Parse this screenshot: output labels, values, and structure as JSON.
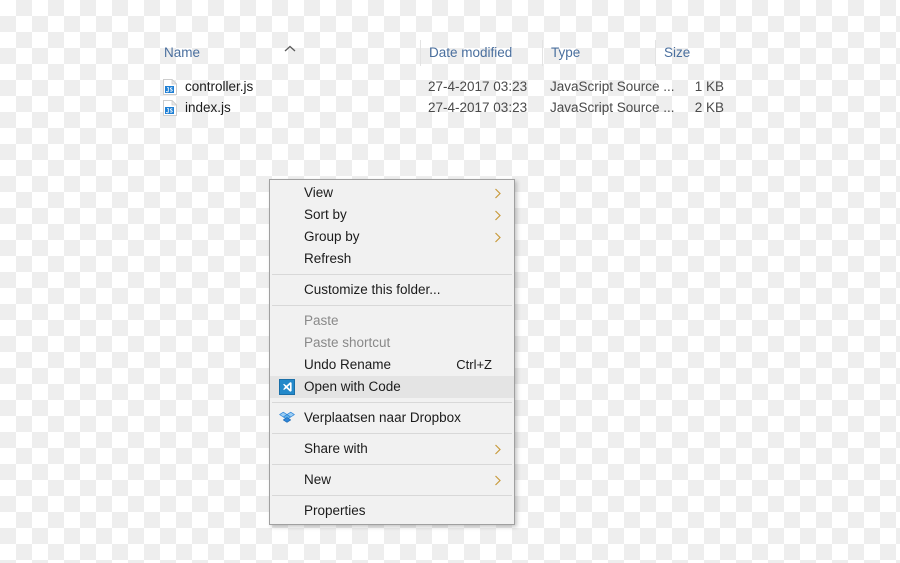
{
  "file_list": {
    "columns": [
      {
        "key": "name",
        "label": "Name",
        "sorted": true,
        "sort_direction": "ascending"
      },
      {
        "key": "date",
        "label": "Date modified"
      },
      {
        "key": "type",
        "label": "Type"
      },
      {
        "key": "size",
        "label": "Size"
      }
    ],
    "rows": [
      {
        "icon": "javascript-file-icon",
        "name": "controller.js",
        "date": "27-4-2017 03:23",
        "type": "JavaScript Source ...",
        "size": "1 KB"
      },
      {
        "icon": "javascript-file-icon",
        "name": "index.js",
        "date": "27-4-2017 03:23",
        "type": "JavaScript Source ...",
        "size": "2 KB"
      }
    ]
  },
  "context_menu": {
    "items": [
      {
        "id": "view",
        "label": "View",
        "submenu": true,
        "disabled": false,
        "highlighted": false,
        "icon": null,
        "shortcut": ""
      },
      {
        "id": "sort-by",
        "label": "Sort by",
        "submenu": true,
        "disabled": false,
        "highlighted": false,
        "icon": null,
        "shortcut": ""
      },
      {
        "id": "group-by",
        "label": "Group by",
        "submenu": true,
        "disabled": false,
        "highlighted": false,
        "icon": null,
        "shortcut": ""
      },
      {
        "id": "refresh",
        "label": "Refresh",
        "submenu": false,
        "disabled": false,
        "highlighted": false,
        "icon": null,
        "shortcut": ""
      },
      {
        "id": "separator-1",
        "type": "separator"
      },
      {
        "id": "customize-folder",
        "label": "Customize this folder...",
        "submenu": false,
        "disabled": false,
        "highlighted": false,
        "icon": null,
        "shortcut": ""
      },
      {
        "id": "separator-2",
        "type": "separator"
      },
      {
        "id": "paste",
        "label": "Paste",
        "submenu": false,
        "disabled": true,
        "highlighted": false,
        "icon": null,
        "shortcut": ""
      },
      {
        "id": "paste-shortcut",
        "label": "Paste shortcut",
        "submenu": false,
        "disabled": true,
        "highlighted": false,
        "icon": null,
        "shortcut": ""
      },
      {
        "id": "undo-rename",
        "label": "Undo Rename",
        "submenu": false,
        "disabled": false,
        "highlighted": false,
        "icon": null,
        "shortcut": "Ctrl+Z"
      },
      {
        "id": "open-with-code",
        "label": "Open with Code",
        "submenu": false,
        "disabled": false,
        "highlighted": true,
        "icon": "vscode-icon",
        "shortcut": ""
      },
      {
        "id": "separator-3",
        "type": "separator"
      },
      {
        "id": "move-to-dropbox",
        "label": "Verplaatsen naar Dropbox",
        "submenu": false,
        "disabled": false,
        "highlighted": false,
        "icon": "dropbox-icon",
        "shortcut": ""
      },
      {
        "id": "separator-4",
        "type": "separator"
      },
      {
        "id": "share-with",
        "label": "Share with",
        "submenu": true,
        "disabled": false,
        "highlighted": false,
        "icon": null,
        "shortcut": ""
      },
      {
        "id": "separator-5",
        "type": "separator"
      },
      {
        "id": "new",
        "label": "New",
        "submenu": true,
        "disabled": false,
        "highlighted": false,
        "icon": null,
        "shortcut": ""
      },
      {
        "id": "separator-6",
        "type": "separator"
      },
      {
        "id": "properties",
        "label": "Properties",
        "submenu": false,
        "disabled": false,
        "highlighted": false,
        "icon": null,
        "shortcut": ""
      }
    ]
  },
  "colors": {
    "menu_background": "#f1f1f1",
    "menu_border": "#a0a0a0",
    "menu_highlight": "#e4e4e4",
    "separator": "#d8d8d8",
    "header_text": "#4a6f9e",
    "body_text": "#1b1b1b",
    "disabled_text": "#898989",
    "submenu_arrow": "#c89b3c",
    "vscode_blue": "#2489ca",
    "dropbox_blue": "#2f86d9"
  }
}
